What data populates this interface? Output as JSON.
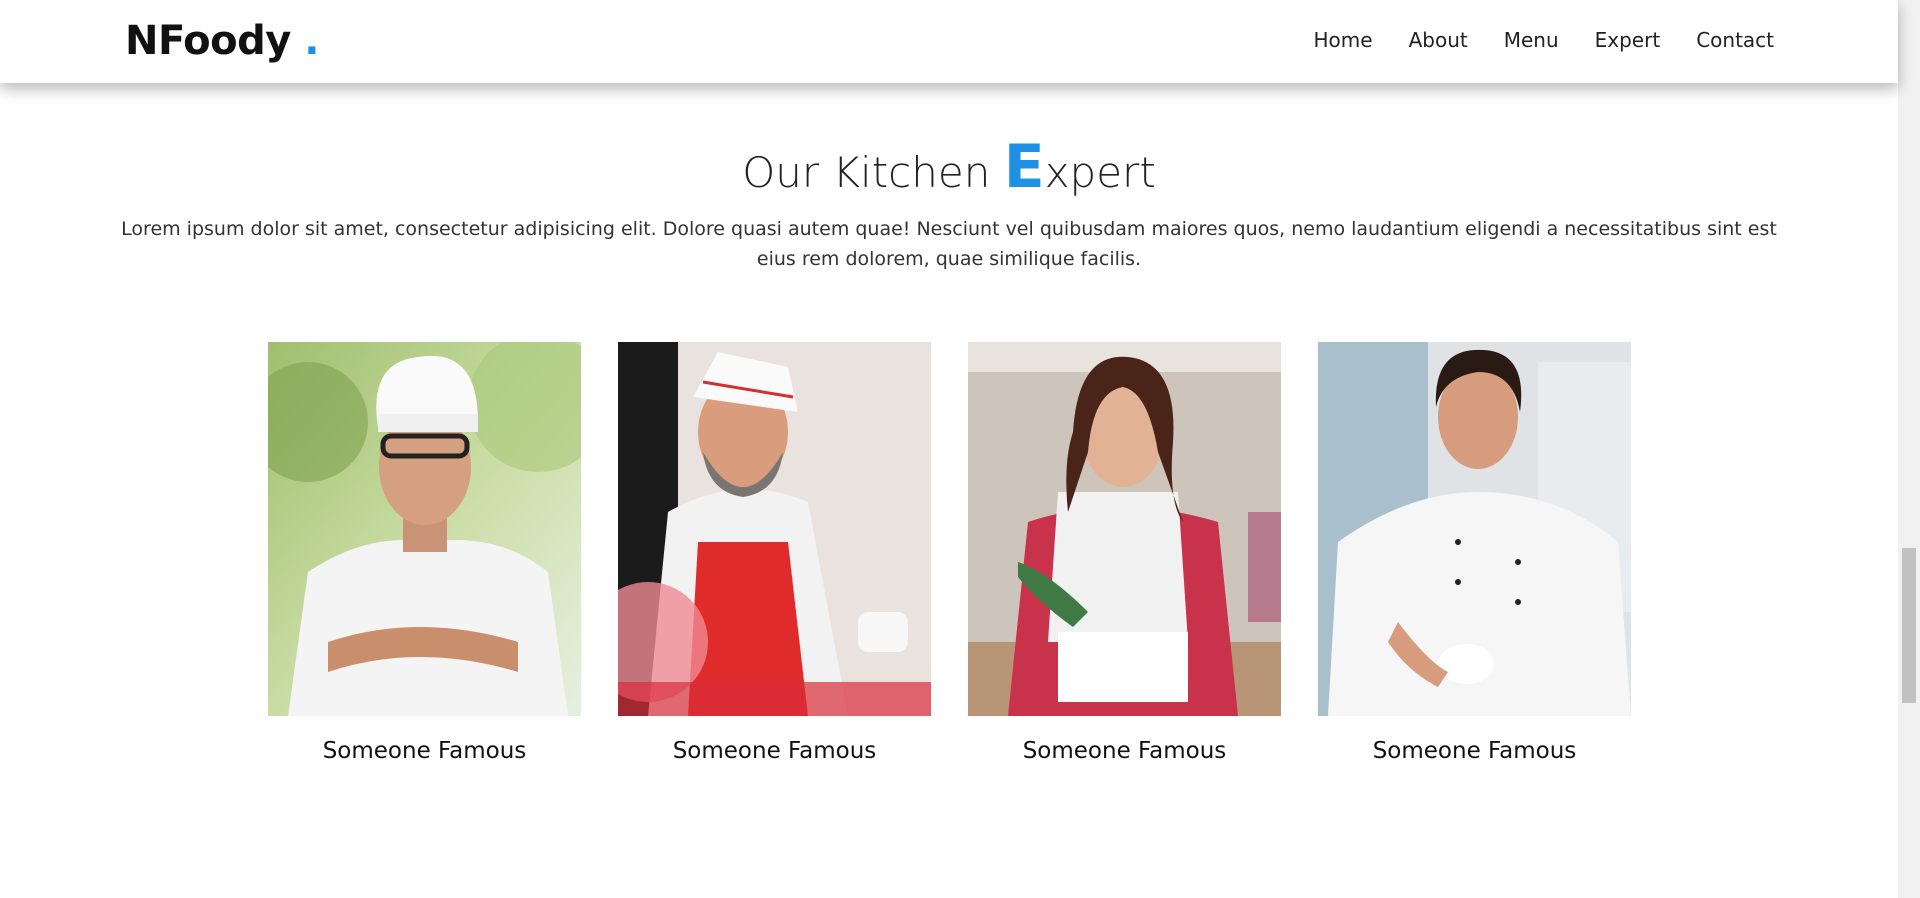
{
  "brand": {
    "name": "NFoody",
    "dot": ".",
    "accent_color": "#1e90e6"
  },
  "nav": {
    "items": [
      {
        "label": "Home"
      },
      {
        "label": "About"
      },
      {
        "label": "Menu"
      },
      {
        "label": "Expert"
      },
      {
        "label": "Contact"
      }
    ]
  },
  "section": {
    "title_prefix": "Our Kitchen ",
    "title_accent": "E",
    "title_suffix": "xpert",
    "description": "Lorem ipsum dolor sit amet, consectetur adipisicing elit. Dolore quasi autem quae! Nesciunt vel quibusdam maiores quos, nemo laudantium eligendi a necessitatibus sint est eius rem dolorem, quae similique facilis."
  },
  "experts": [
    {
      "name": "Someone Famous",
      "photo": "chef-with-glasses-arms-crossed"
    },
    {
      "name": "Someone Famous",
      "photo": "chef-with-red-apron"
    },
    {
      "name": "Someone Famous",
      "photo": "pastry-chef-woman"
    },
    {
      "name": "Someone Famous",
      "photo": "chef-holding-cup"
    }
  ]
}
